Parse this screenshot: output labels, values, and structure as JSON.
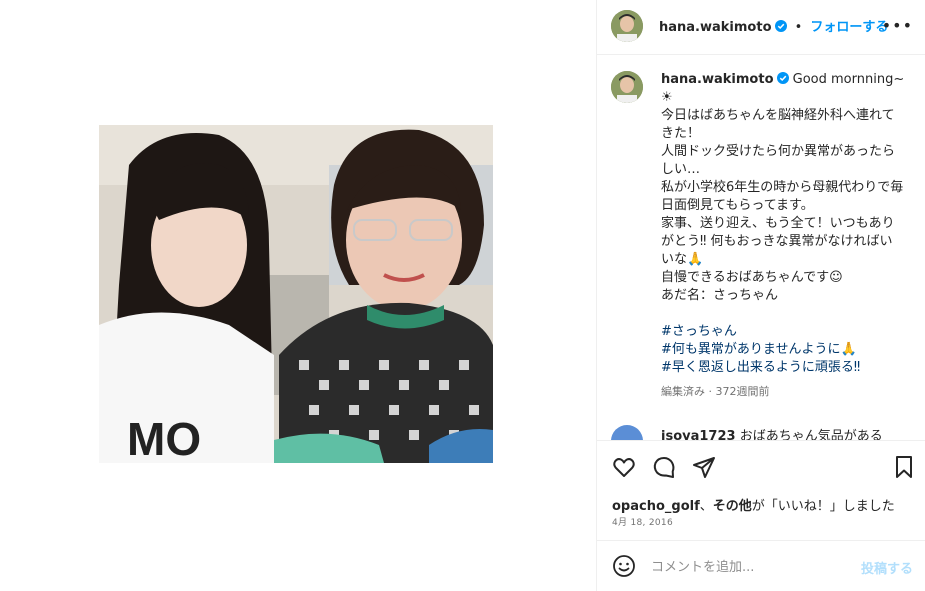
{
  "post": {
    "author": "hana.wakimoto",
    "follow_label": "フォローする",
    "separator": "•",
    "more_label": "•••"
  },
  "caption": {
    "username": "hana.wakimoto",
    "lead": "Good mornning~",
    "sun": "☀",
    "body": "今日はばあちゃんを脳神経外科へ連れてきた！\n人間ドック受けたら何か異常があったらしい…\n私が小学校6年生の時から母親代わりで毎日面倒見てもらってます。\n家事、送り迎え、もう全て！いつもありがとう‼︎ 何もおっきな異常がなければいいな🙏\n自慢できるおばあちゃんです☺︎\nあだ名：さっちゃん",
    "hashtags": [
      "#さっちゃん",
      "#何も異常がありませんように🙏",
      "#早く恩返し出来るように頑張る‼︎"
    ],
    "meta": "編集済み · 372週間前"
  },
  "next_comment": {
    "username": "isoya1723",
    "text": "おばあちゃん気品がある"
  },
  "likes": {
    "user": "opacho_golf",
    "sep": "、",
    "others": "その他",
    "suffix": "が「いいね！」しました"
  },
  "date": "4月 18, 2016",
  "comment_box": {
    "placeholder": "コメントを追加...",
    "post_label": "投稿する"
  },
  "colors": {
    "accent": "#0095f6",
    "hashtag": "#00376b",
    "muted": "#737373",
    "post_disabled": "#b2dffc"
  }
}
